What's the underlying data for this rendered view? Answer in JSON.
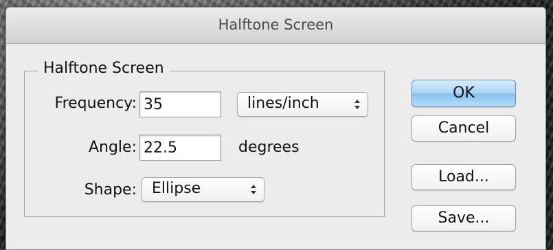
{
  "dialog": {
    "title": "Halftone Screen"
  },
  "group": {
    "legend": "Halftone Screen"
  },
  "frequency": {
    "label": "Frequency:",
    "value": "35",
    "unit": "lines/inch"
  },
  "angle": {
    "label": "Angle:",
    "value": "22.5",
    "unit": "degrees"
  },
  "shape": {
    "label": "Shape:",
    "value": "Ellipse"
  },
  "buttons": {
    "ok": "OK",
    "cancel": "Cancel",
    "load": "Load...",
    "save": "Save..."
  }
}
